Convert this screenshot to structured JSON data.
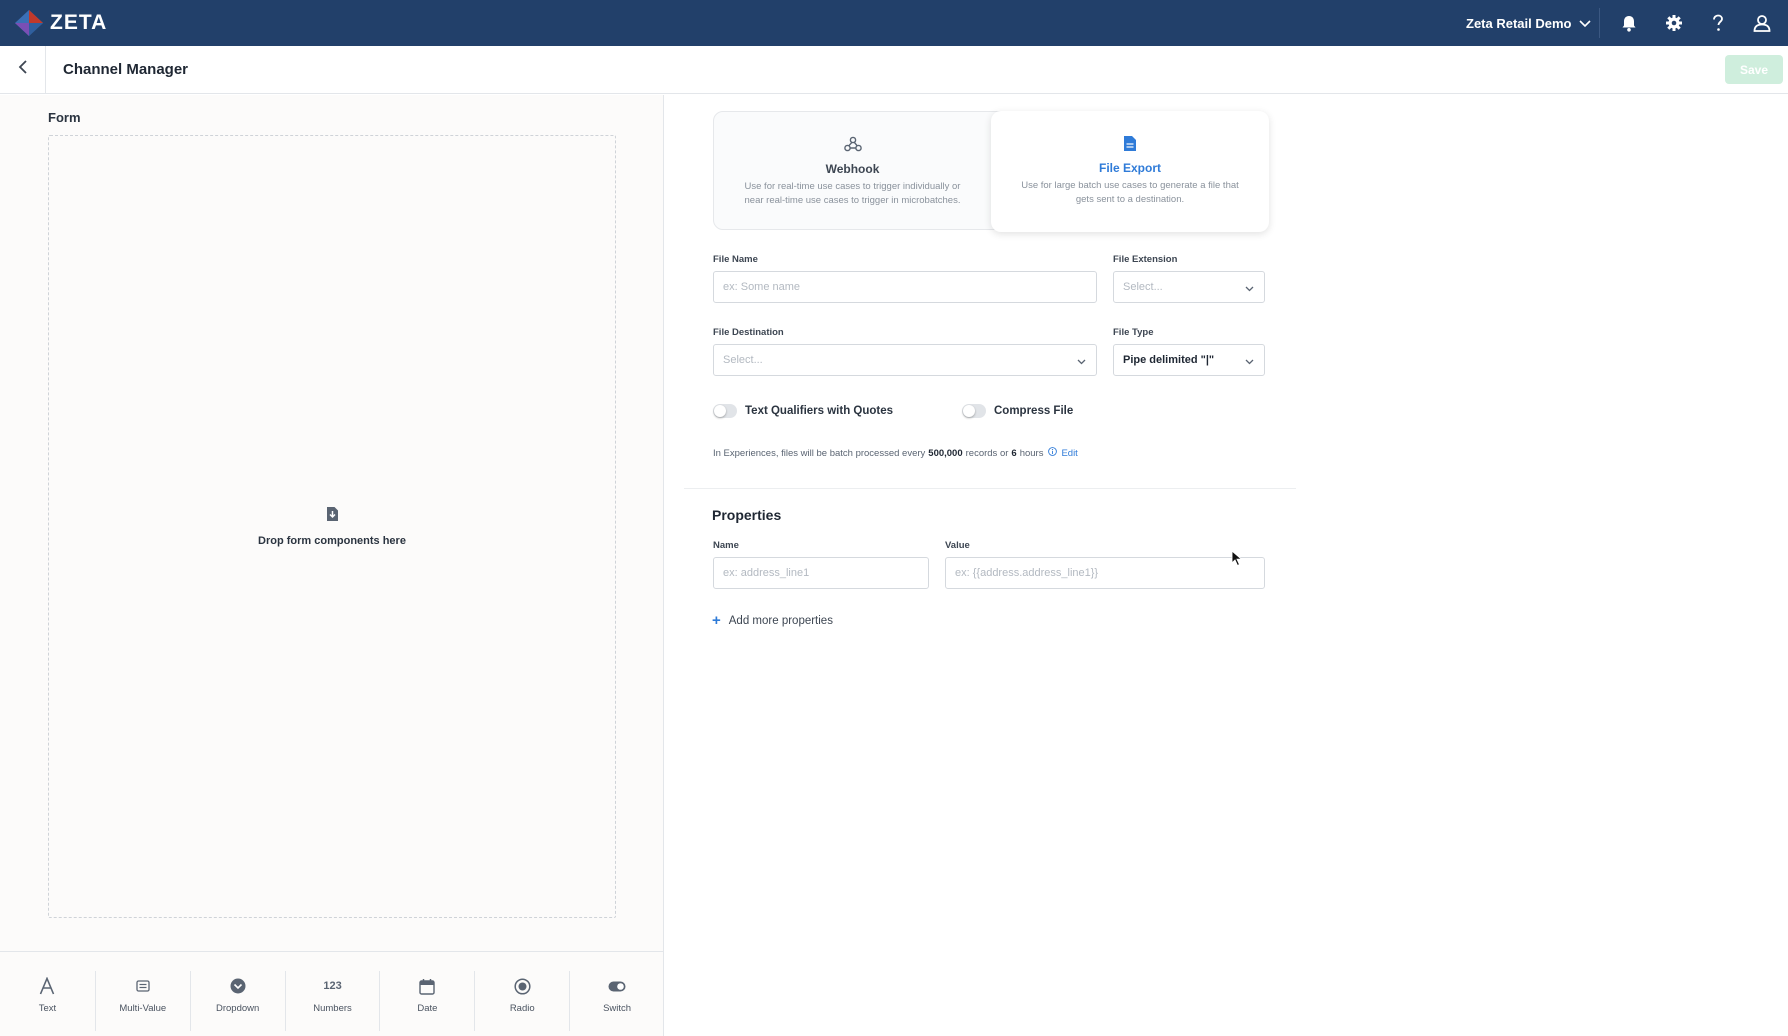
{
  "app": {
    "brand": "ZETA",
    "org_name": "Zeta Retail Demo"
  },
  "colors": {
    "topbar": "#22406a",
    "accent": "#2f7bd8",
    "save_disabled": "#cfeedd"
  },
  "header": {
    "title": "Channel Manager",
    "save_label": "Save"
  },
  "icons": [
    "zeta-logo-icon",
    "chevron-down-icon",
    "bell-icon",
    "gear-icon",
    "help-icon",
    "user-icon",
    "back-arrow-icon",
    "file-download-icon",
    "webhook-icon",
    "file-icon",
    "info-icon",
    "plus-icon",
    "cursor-icon"
  ],
  "form": {
    "label": "Form",
    "drop_text": "Drop form components here",
    "palette": [
      {
        "label": "Text",
        "icon": "text-icon"
      },
      {
        "label": "Multi-Value",
        "icon": "multi-value-icon"
      },
      {
        "label": "Dropdown",
        "icon": "dropdown-icon"
      },
      {
        "label": "Numbers",
        "icon": "numbers-icon",
        "glyph": "123"
      },
      {
        "label": "Date",
        "icon": "calendar-icon"
      },
      {
        "label": "Radio",
        "icon": "radio-icon"
      },
      {
        "label": "Switch",
        "icon": "switch-icon"
      }
    ]
  },
  "channel_types": {
    "selected": "File Export",
    "items": [
      {
        "title": "Webhook",
        "desc": "Use for real-time use cases to trigger individually or near real-time use cases to trigger in microbatches."
      },
      {
        "title": "File Export",
        "desc": "Use for large batch use cases to generate a file that gets sent to a destination."
      }
    ]
  },
  "fields": {
    "file_name": {
      "label": "File Name",
      "placeholder": "ex: Some name",
      "value": ""
    },
    "file_extension": {
      "label": "File Extension",
      "placeholder": "Select..."
    },
    "file_destination": {
      "label": "File Destination",
      "placeholder": "Select..."
    },
    "file_type": {
      "label": "File Type",
      "value": "Pipe delimited \"|\""
    }
  },
  "toggles": {
    "text_qualifiers": {
      "label": "Text Qualifiers with Quotes",
      "on": false
    },
    "compress_file": {
      "label": "Compress File",
      "on": false
    }
  },
  "batch_note": {
    "prefix": "In Experiences, files will be batch processed every",
    "records": "500,000",
    "middle": "records or",
    "hours": "6",
    "suffix": "hours",
    "edit_label": "Edit"
  },
  "properties": {
    "title": "Properties",
    "name_label": "Name",
    "name_placeholder": "ex: address_line1",
    "value_label": "Value",
    "value_placeholder": "ex: {{address.address_line1}}",
    "add_label": "Add more properties"
  }
}
